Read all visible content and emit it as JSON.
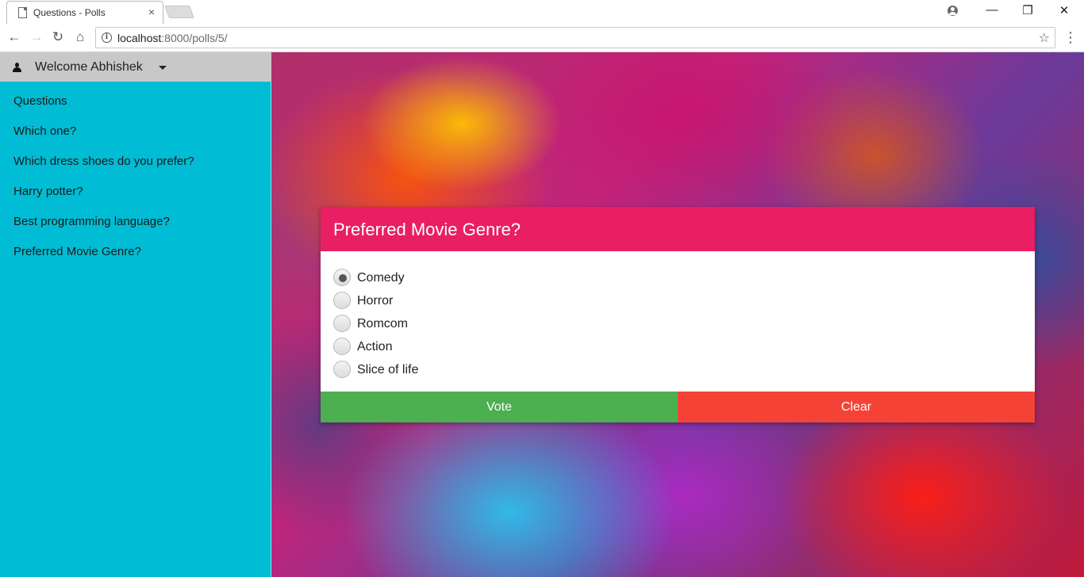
{
  "browser": {
    "tab_title": "Questions - Polls",
    "tab_close": "×",
    "url_host": "localhost",
    "url_path": ":8000/polls/5/",
    "window_controls": {
      "minimize": "—",
      "restore": "❐",
      "close": "✕"
    },
    "icons": {
      "back": "←",
      "forward": "→",
      "reload": "↻",
      "home": "⌂",
      "star": "☆",
      "menu": "⋮",
      "info": "i"
    }
  },
  "sidebar": {
    "welcome": "Welcome Abhishek",
    "items": [
      {
        "label": "Questions"
      },
      {
        "label": "Which one?"
      },
      {
        "label": "Which dress shoes do you prefer?"
      },
      {
        "label": "Harry potter?"
      },
      {
        "label": "Best programming language?"
      },
      {
        "label": "Preferred Movie Genre?"
      }
    ]
  },
  "poll": {
    "title": "Preferred Movie Genre?",
    "choices": [
      {
        "label": "Comedy",
        "checked": true
      },
      {
        "label": "Horror",
        "checked": false
      },
      {
        "label": "Romcom",
        "checked": false
      },
      {
        "label": "Action",
        "checked": false
      },
      {
        "label": "Slice of life",
        "checked": false
      }
    ],
    "vote_label": "Vote",
    "clear_label": "Clear"
  },
  "colors": {
    "sidebar": "#00bcd4",
    "user_bar": "#c8c8c8",
    "poll_header": "#e91e63",
    "vote": "#4caf50",
    "clear": "#f44336"
  }
}
